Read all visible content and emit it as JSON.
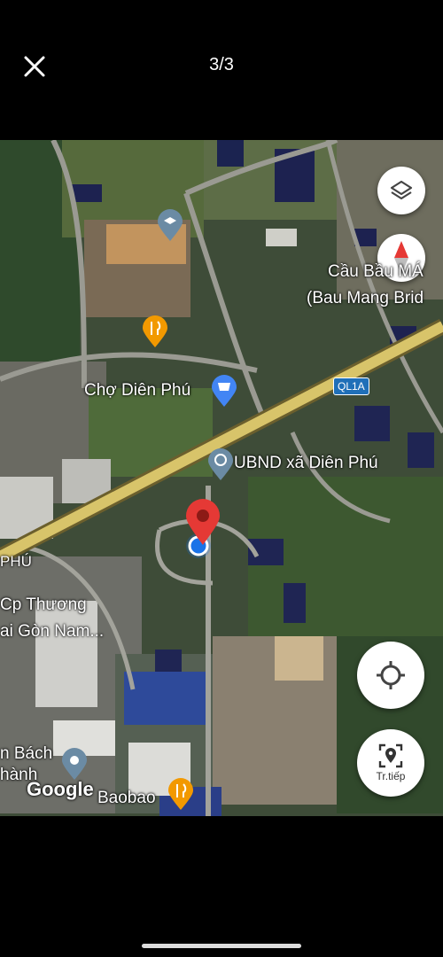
{
  "header": {
    "counter": "3/3"
  },
  "map": {
    "labels": {
      "cau_bau_mang": "Cầu Bầu MÁ",
      "bau_mang_bridge": "(Bau Mang Brid",
      "cho_dien_phu": "Chợ Diên Phú",
      "ql1a": "QL1A",
      "ubnd": "UBND xã Diên Phú",
      "phu": "PHÚ",
      "cp_thuong": "Cp Thương",
      "sai_gon_nam": "ai Gòn Nam...",
      "bach": "n Bách",
      "thanh": "hành",
      "google": "Google",
      "baobao": "Baobao"
    },
    "controls": {
      "follow_label": "Tr.tiếp"
    },
    "colors": {
      "pin_red": "#e53935",
      "location_blue": "#1a73e8",
      "highway": "#d8c46a",
      "poi_orange": "#f29900",
      "poi_blue": "#4285f4",
      "poi_gray": "#6b8ba4"
    }
  }
}
